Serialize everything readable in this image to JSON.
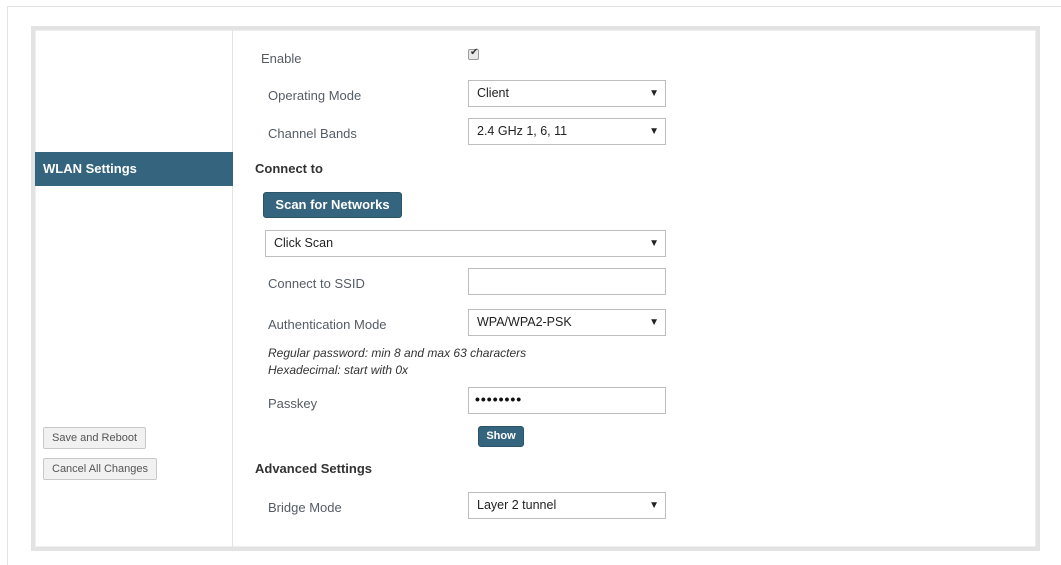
{
  "sidebar": {
    "active_item": "WLAN Settings",
    "save_reboot": "Save and Reboot",
    "cancel_changes": "Cancel All Changes"
  },
  "form": {
    "enable_label": "Enable",
    "enable_checked": true,
    "operating_mode_label": "Operating Mode",
    "operating_mode_value": "Client",
    "channel_bands_label": "Channel Bands",
    "channel_bands_value": "2.4 GHz 1, 6, 11",
    "connect_to_heading": "Connect to",
    "scan_button": "Scan for Networks",
    "scan_select_value": "Click Scan",
    "ssid_label": "Connect to SSID",
    "ssid_value": "",
    "auth_mode_label": "Authentication Mode",
    "auth_mode_value": "WPA/WPA2-PSK",
    "password_note_1": "Regular password: min 8 and max 63 characters",
    "password_note_2": "Hexadecimal: start with 0x",
    "passkey_label": "Passkey",
    "passkey_masked": "••••••••",
    "show_button": "Show",
    "advanced_heading": "Advanced Settings",
    "bridge_mode_label": "Bridge Mode",
    "bridge_mode_value": "Layer 2 tunnel"
  },
  "icons": {
    "dropdown": "caret-down-icon",
    "check": "checkmark-icon"
  },
  "colors": {
    "accent": "#35647e"
  }
}
